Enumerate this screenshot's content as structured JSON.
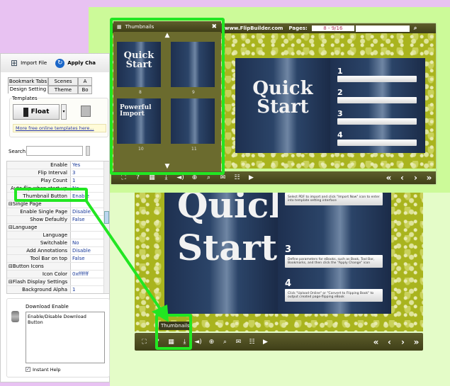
{
  "left_panel": {
    "toolbar": {
      "import_label": "Import File",
      "apply_label": "Apply Cha"
    },
    "tabs_row1": [
      "Bookmark Tabs",
      "Scenes",
      "A"
    ],
    "tabs_row2": [
      "Design Setting",
      "Theme",
      "Bo"
    ],
    "templates": {
      "group_label": "Templates",
      "template_name": "Float",
      "more_link": "More free online templates here..."
    },
    "search": {
      "label": "Search:",
      "value": ""
    },
    "properties": [
      {
        "key": "Enable",
        "value": "Yes",
        "level": 2
      },
      {
        "key": "Flip Interval",
        "value": "3",
        "level": 2
      },
      {
        "key": "Play Count",
        "value": "1",
        "level": 2
      },
      {
        "key": "Auto flip when start up",
        "value": "No",
        "level": 2
      },
      {
        "key": "Thumbnail Button",
        "value": "Enable",
        "level": 1
      },
      {
        "key": "⊟Single Page",
        "value": "",
        "level": 0
      },
      {
        "key": "Enable Single Page",
        "value": "Disable",
        "level": 2
      },
      {
        "key": "Show Defaultly",
        "value": "False",
        "level": 2
      },
      {
        "key": "⊟Language",
        "value": "",
        "level": 0
      },
      {
        "key": "Language",
        "value": "",
        "level": 2
      },
      {
        "key": "Switchable",
        "value": "No",
        "level": 2
      },
      {
        "key": "Add Annotations",
        "value": "Disable",
        "level": 1
      },
      {
        "key": "Tool Bar on top",
        "value": "False",
        "level": 1
      },
      {
        "key": "⊟Button Icons",
        "value": "",
        "level": 0
      },
      {
        "key": "Icon Color",
        "value": "0xffffff",
        "level": 1
      },
      {
        "key": "⊟Flash Display Settings",
        "value": "",
        "level": 0
      },
      {
        "key": "Background Alpha",
        "value": "1",
        "level": 1
      }
    ],
    "help": {
      "title": "Download Enable",
      "description": "Enable/Disable Download Button",
      "instant_help_label": "Instant Help",
      "instant_help_checked": true
    }
  },
  "top_viewer": {
    "site": "www.FlipBuilder.com",
    "pages_label": "Pages:",
    "pages_value": "8 - 9/16",
    "search_value": "",
    "thumbnails": {
      "title": "Thumbnails",
      "items": [
        {
          "page": "8",
          "text": "Quick Start"
        },
        {
          "page": "9",
          "text": ""
        },
        {
          "page": "10",
          "text": "Powerful Import"
        },
        {
          "page": "11",
          "text": ""
        }
      ]
    },
    "left_page_title": "Quick Start",
    "steps": [
      "1",
      "2",
      "3",
      "4"
    ]
  },
  "bottom_viewer": {
    "left_page_title": "Quick Start",
    "tooltip": "Thumbnails",
    "steps": [
      {
        "n": "",
        "text": "Select PDF to import and click \"Import Now\" icon to enter into template setting interface"
      },
      {
        "n": "3",
        "text": "Define parameters for eBooks, such as Book, Tool Bar, Bookmarks, and then click the \"Apply Change\" icon"
      },
      {
        "n": "4",
        "text": "Click \"Upload Online\" or \"Convert to Flipping Book\" to output created page-flipping eBook"
      }
    ]
  },
  "toolbar_icons": [
    "fit-icon",
    "help-icon",
    "thumbnails-icon",
    "download-icon",
    "sound-icon",
    "zoom-in-icon",
    "search-icon",
    "email-icon",
    "share-icon",
    "play-icon"
  ],
  "nav_icons": [
    "first-page-icon",
    "prev-page-icon",
    "next-page-icon",
    "last-page-icon"
  ],
  "colors": {
    "highlight": "#22e622",
    "toolbar": "#4a4a20",
    "pattern": "#a9b41e"
  }
}
